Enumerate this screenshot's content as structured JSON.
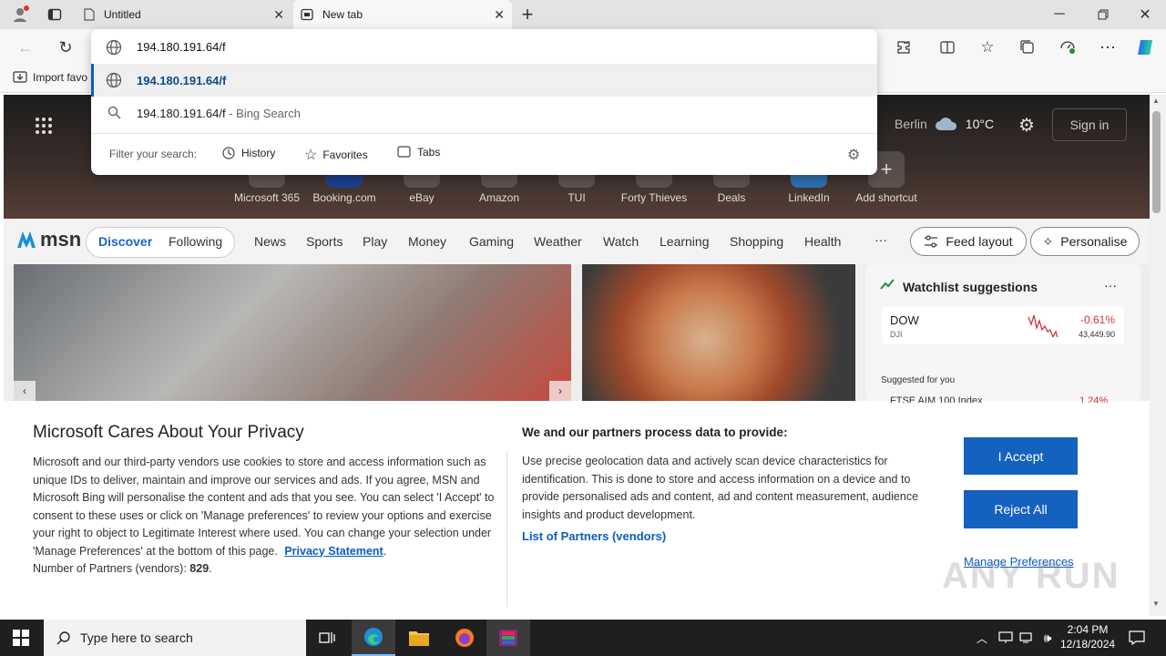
{
  "browser": {
    "tabs": [
      {
        "label": "Untitled",
        "icon": "page-icon"
      },
      {
        "label": "New tab",
        "icon": "newtab-icon"
      }
    ],
    "address_value": "194.180.191.64/f",
    "favorites_bar": {
      "import_label": "Import favo"
    }
  },
  "suggestions": {
    "top_match": "194.180.191.64/f",
    "search_query": "194.180.191.64/f",
    "search_suffix": " - Bing Search",
    "filter_label": "Filter your search:",
    "filters": [
      "History",
      "Favorites",
      "Tabs"
    ]
  },
  "newtab": {
    "weather": {
      "city": "Berlin",
      "temp": "10°C"
    },
    "sign_in": "Sign in",
    "shortcuts": [
      "Microsoft 365",
      "Booking.com",
      "eBay",
      "Amazon",
      "TUI",
      "Forty Thieves",
      "Deals",
      "LinkedIn",
      "Add shortcut"
    ],
    "msn_logo": "msn",
    "nav": [
      "Discover",
      "Following",
      "News",
      "Sports",
      "Play",
      "Money",
      "Gaming",
      "Weather",
      "Watch",
      "Learning",
      "Shopping",
      "Health"
    ],
    "more": "···",
    "feed_layout": "Feed layout",
    "personalise": "Personalise",
    "watchlist": {
      "title": "Watchlist suggestions",
      "symbol": "DOW",
      "exchange": "DJI",
      "change": "-0.61%",
      "price": "43,449.90",
      "suggested": "Suggested for you",
      "next_symbol": "FTSE AIM 100 Index",
      "next_change": "1.24%"
    }
  },
  "privacy": {
    "title": "Microsoft Cares About Your Privacy",
    "body": "Microsoft and our third-party vendors use cookies to store and access information such as unique IDs to deliver, maintain and improve our services and ads. If you agree, MSN and Microsoft Bing will personalise the content and ads that you see. You can select 'I Accept' to consent to these uses or click on 'Manage preferences' to review your options and exercise your right to object to Legitimate Interest where used. You can change your selection under 'Manage Preferences' at the bottom of this page.",
    "statement_link": "Privacy Statement",
    "partners_label": "Number of Partners (vendors):",
    "partners_count": "829",
    "partners_title": "We and our partners process data to provide:",
    "partners_body": "Use precise geolocation data and actively scan device characteristics for identification. This is done to store and access information on a device and to provide personalised ads and content, ad and content measurement, audience insights and product development.",
    "vendors_link": "List of Partners (vendors)",
    "accept": "I Accept",
    "reject": "Reject All",
    "manage": "Manage Preferences"
  },
  "taskbar": {
    "search_placeholder": "Type here to search",
    "time": "2:04 PM",
    "date": "12/18/2024"
  },
  "watermark": "ANY RUN"
}
